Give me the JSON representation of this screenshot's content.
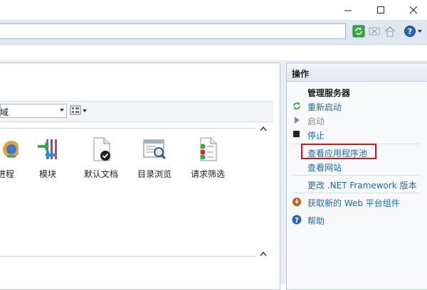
{
  "window": {
    "controls": {
      "minimize": "minimize-icon",
      "maximize": "maximize-icon",
      "close": "close-icon"
    }
  },
  "toolbar": {
    "icons": [
      "refresh-icon",
      "stop-icon",
      "home-icon",
      "help-icon"
    ]
  },
  "center": {
    "filter_value": "域",
    "features": [
      {
        "label": "进程",
        "icon": "worker-processes-icon"
      },
      {
        "label": "模块",
        "icon": "modules-icon"
      },
      {
        "label": "默认文档",
        "icon": "default-document-icon"
      },
      {
        "label": "目录浏览",
        "icon": "directory-browsing-icon"
      },
      {
        "label": "请求筛选",
        "icon": "request-filtering-icon"
      }
    ]
  },
  "actions": {
    "title": "操作",
    "group_title": "管理服务器",
    "items": [
      {
        "label": "重新启动",
        "icon": "restart-icon",
        "enabled": true
      },
      {
        "label": "启动",
        "icon": "start-icon",
        "enabled": false
      },
      {
        "label": "停止",
        "icon": "stop-square-icon",
        "enabled": true
      },
      {
        "label": "查看应用程序池",
        "enabled": true,
        "highlighted": true
      },
      {
        "label": "查看网站",
        "enabled": true
      },
      {
        "label": "更改 .NET Framework 版本",
        "enabled": true
      },
      {
        "label": "获取新的 Web 平台组件",
        "icon": "web-platform-icon",
        "enabled": true
      },
      {
        "label": "帮助",
        "icon": "help-icon",
        "enabled": true
      }
    ]
  },
  "colors": {
    "link": "#1a6ca8",
    "highlight": "#e01010",
    "panel_border": "#b9c6d6"
  }
}
